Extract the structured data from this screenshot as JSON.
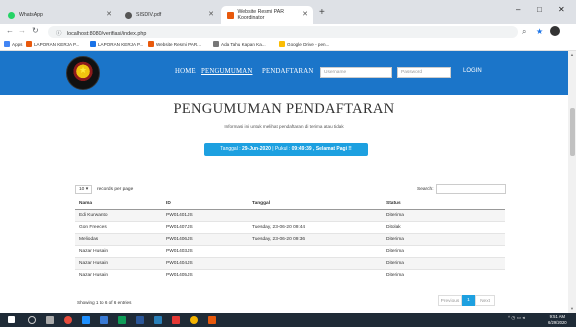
{
  "browser": {
    "tabs": [
      {
        "label": "WhatsApp",
        "fav_color": "#25d366"
      },
      {
        "label": "SISDIV.pdf",
        "fav_color": "#555555"
      },
      {
        "label": "Website Resmi PAR Koordinator",
        "fav_color": "#e8590c"
      }
    ],
    "url": "localhost:8080/verifiasi/index.php",
    "bookmarks": [
      "Apps",
      "LAPORAN KERJA P...",
      "LAPORAN KERJA P...",
      "Website Resmi PAR...",
      "Ada Tahu Kapan Ka...",
      "Google Drive - pen..."
    ]
  },
  "header": {
    "nav": [
      "HOME",
      "PENGUMUMAN",
      "PENDAFTARAN"
    ],
    "username_placeholder": "Username",
    "password_placeholder": "Password",
    "login_label": "LOGIN"
  },
  "main": {
    "title": "PENGUMUMAN PENDAFTARAN",
    "subtitle": "Informasi ini untuk melihat pendaftaran di terima atau tidak",
    "banner_prefix": "Tanggal : ",
    "banner_date": "29-Jun-2020",
    "banner_mid": " | Pukul : ",
    "banner_time": "09:49:39 , Selamat Pagi !!"
  },
  "table": {
    "length_value": "10",
    "length_text": "records per page",
    "search_label": "Search:",
    "headers": [
      "Nama",
      "ID",
      "Tanggal",
      "Status"
    ],
    "rows": [
      [
        "Edi Kurwanto",
        "PW01401JS",
        "",
        "Diterima"
      ],
      [
        "Gon Freeces",
        "PW01407JS",
        "Tuesday, 23-06-20 09:44",
        "Ditolak"
      ],
      [
        "Meliodas",
        "PW01406JS",
        "Tuesday, 23-06-20 09:36",
        "Diterima"
      ],
      [
        "Nazar Husain",
        "PW01403JS",
        "",
        "Diterima"
      ],
      [
        "Nazar Husain",
        "PW01404JS",
        "",
        "Diterima"
      ],
      [
        "Nazar Husain",
        "PW01405JS",
        "",
        "Diterima"
      ]
    ],
    "info": "Showing 1 to 6 of 6 entries",
    "prev_label": "Previous",
    "current_page": "1",
    "next_label": "Next"
  },
  "taskbar": {
    "time": "9:51 AM",
    "date": "6/29/2020"
  },
  "colors": {
    "header_blue": "#1b75c9",
    "banner_blue": "#1da0e0"
  }
}
